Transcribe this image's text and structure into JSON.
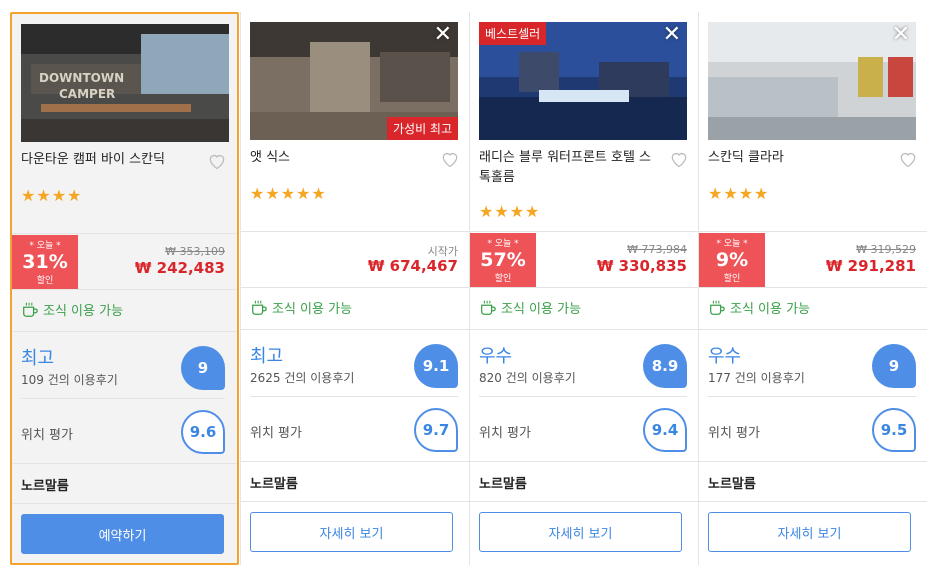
{
  "hotels": [
    {
      "name": "다운타운 캠퍼 바이 스칸딕",
      "stars": "★★★★",
      "photo_tag": "",
      "discount": {
        "today": "* 오늘 *",
        "pct": "31%",
        "off": "할인"
      },
      "price_label": "",
      "price_original": "₩ 353,109",
      "price_now": "₩ 242,483",
      "breakfast": "조식 이용 가능",
      "grade": "최고",
      "reviews": "109 건의 이용후기",
      "score": "9",
      "loc_label": "위치 평가",
      "loc_score": "9.6",
      "district": "노르말름",
      "button": "예약하기"
    },
    {
      "name": "앳 식스",
      "stars": "★★★★★",
      "photo_tag": "가성비 최고",
      "discount": null,
      "price_label": "시작가",
      "price_original": "",
      "price_now": "₩ 674,467",
      "breakfast": "조식 이용 가능",
      "grade": "최고",
      "reviews": "2625 건의 이용후기",
      "score": "9.1",
      "loc_label": "위치 평가",
      "loc_score": "9.7",
      "district": "노르말름",
      "button": "자세히 보기"
    },
    {
      "name": "래디슨 블루 워터프론트 호텔 스톡홀름",
      "stars": "★★★★",
      "photo_tag": "베스트셀러",
      "discount": {
        "today": "* 오늘 *",
        "pct": "57%",
        "off": "할인"
      },
      "price_label": "",
      "price_original": "₩ 773,984",
      "price_now": "₩ 330,835",
      "breakfast": "조식 이용 가능",
      "grade": "우수",
      "reviews": "820 건의 이용후기",
      "score": "8.9",
      "loc_label": "위치 평가",
      "loc_score": "9.4",
      "district": "노르말름",
      "button": "자세히 보기"
    },
    {
      "name": "스칸딕 클라라",
      "stars": "★★★★",
      "photo_tag": "",
      "discount": {
        "today": "* 오늘 *",
        "pct": "9%",
        "off": "할인"
      },
      "price_label": "",
      "price_original": "₩ 319,529",
      "price_now": "₩ 291,281",
      "breakfast": "조식 이용 가능",
      "grade": "우수",
      "reviews": "177 건의 이용후기",
      "score": "9",
      "loc_label": "위치 평가",
      "loc_score": "9.5",
      "district": "노르말름",
      "button": "자세히 보기"
    }
  ],
  "close_glyph": "✕",
  "colors": {
    "accent": "#4f8ee6",
    "discount": "#ee5358",
    "price": "#d9262b",
    "star": "#f5a623",
    "breakfast": "#3aa14a",
    "selected_border": "#f4a22d"
  }
}
